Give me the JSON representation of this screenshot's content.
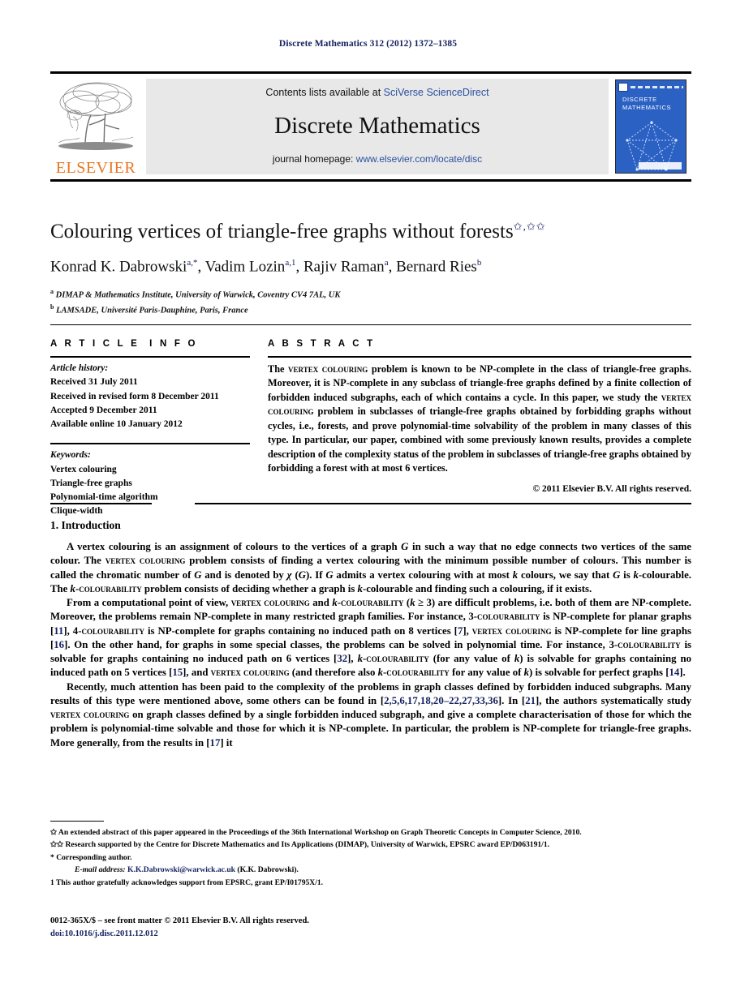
{
  "running_head": "Discrete Mathematics 312 (2012) 1372–1385",
  "masthead": {
    "publisher_name": "ELSEVIER",
    "contents_prefix": "Contents lists available at ",
    "contents_link": "SciVerse ScienceDirect",
    "journal_name": "Discrete Mathematics",
    "homepage_prefix": "journal homepage: ",
    "homepage_url": "www.elsevier.com/locate/disc",
    "cover_title_line1": "DISCRETE",
    "cover_title_line2": "MATHEMATICS"
  },
  "article": {
    "title": "Colouring vertices of triangle-free graphs without forests",
    "title_marks": "✩,✩✩",
    "authors_html": "Konrad K. Dabrowski<sup>a,*</sup>, Vadim Lozin<sup>a,1</sup>, Rajiv Raman<sup>a</sup>, Bernard Ries<sup>b</sup>",
    "affiliations": [
      {
        "mark": "a",
        "text": "DIMAP & Mathematics Institute, University of Warwick, Coventry CV4 7AL, UK"
      },
      {
        "mark": "b",
        "text": "LAMSADE, Université Paris-Dauphine, Paris, France"
      }
    ]
  },
  "info": {
    "heading_left": "A R T I C L E",
    "heading_right": "I N F O",
    "history_label": "Article history:",
    "history": [
      "Received 31 July 2011",
      "Received in revised form 8 December 2011",
      "Accepted 9 December 2011",
      "Available online 10 January 2012"
    ],
    "keywords_label": "Keywords:",
    "keywords": [
      "Vertex colouring",
      "Triangle-free graphs",
      "Polynomial-time algorithm",
      "Clique-width"
    ]
  },
  "abstract": {
    "heading": "A B S T R A C T",
    "text_html": "The <span class=\"sc\">vertex colouring</span> problem is known to be NP-complete in the class of triangle-free graphs. Moreover, it is NP-complete in any subclass of triangle-free graphs defined by a finite collection of forbidden induced subgraphs, each of which contains a cycle. In this paper, we study the <span class=\"sc\">vertex colouring</span> problem in subclasses of triangle-free graphs obtained by forbidding graphs without cycles, i.e., forests, and prove polynomial-time solvability of the problem in many classes of this type. In particular, our paper, combined with some previously known results, provides a complete description of the complexity status of the problem in subclasses of triangle-free graphs obtained by forbidding a forest with at most 6 vertices.",
    "copyright": "© 2011 Elsevier B.V. All rights reserved."
  },
  "body": {
    "section_heading": "1. Introduction",
    "paragraphs_html": [
      "A vertex colouring is an assignment of colours to the vertices of a graph <i>G</i> in such a way that no edge connects two vertices of the same colour. The <span class=\"sc\">vertex colouring</span> problem consists of finding a vertex colouring with the minimum possible number of colours. This number is called the chromatic number of <i>G</i> and is denoted by <i>χ</i> (<i>G</i>). If <i>G</i> admits a vertex colouring with at most <i>k</i> colours, we say that <i>G</i> is <i>k</i>-colourable. The <i>k</i>-<span class=\"sc\">colourability</span> problem consists of deciding whether a graph is <i>k</i>-colourable and finding such a colouring, if it exists.",
      "From a computational point of view, <span class=\"sc\">vertex colouring</span> and <i>k</i>-<span class=\"sc\">colourability</span> (<i>k</i> ≥ 3) are difficult problems, i.e. both of them are NP-complete. Moreover, the problems remain NP-complete in many restricted graph families. For instance, 3-<span class=\"sc\">colourability</span> is NP-complete for planar graphs [<span class=\"ref\">11</span>], 4-<span class=\"sc\">colourability</span> is NP-complete for graphs containing no induced path on 8 vertices [<span class=\"ref\">7</span>], <span class=\"sc\">vertex colouring</span> is NP-complete for line graphs [<span class=\"ref\">16</span>]. On the other hand, for graphs in some special classes, the problems can be solved in polynomial time. For instance, 3-<span class=\"sc\">colourability</span> is solvable for graphs containing no induced path on 6 vertices [<span class=\"ref\">32</span>], <i>k</i>-<span class=\"sc\">colourability</span> (for any value of <i>k</i>) is solvable for graphs containing no induced path on 5 vertices [<span class=\"ref\">15</span>], and <span class=\"sc\">vertex colouring</span> (and therefore also <i>k</i>-<span class=\"sc\">colourability</span> for any value of <i>k</i>) is solvable for perfect graphs [<span class=\"ref\">14</span>].",
      "Recently, much attention has been paid to the complexity of the problems in graph classes defined by forbidden induced subgraphs. Many results of this type were mentioned above, some others can be found in [<span class=\"ref\">2,5,6,17,18,20–22,27,33,36</span>]. In [<span class=\"ref\">21</span>], the authors systematically study <span class=\"sc\">vertex colouring</span> on graph classes defined by a single forbidden induced subgraph, and give a complete characterisation of those for which the problem is polynomial-time solvable and those for which it is NP-complete. In particular, the problem is NP-complete for triangle-free graphs. More generally, from the results in [<span class=\"ref\">17</span>] it"
    ]
  },
  "footnotes": [
    {
      "mark": "✩",
      "html": "An extended abstract of this paper appeared in the Proceedings of the 36th International Workshop on Graph Theoretic Concepts in Computer Science, 2010."
    },
    {
      "mark": "✩✩",
      "html": "Research supported by the Centre for Discrete Mathematics and Its Applications (DIMAP), University of Warwick, EPSRC award EP/D063191/1."
    },
    {
      "mark": "*",
      "html": "Corresponding author."
    },
    {
      "mark": "",
      "html": "<span class=\"email-lbl\">E-mail address:</span> <span class=\"mail\">K.K.Dabrowski@warwick.ac.uk</span> (K.K. Dabrowski)."
    },
    {
      "mark": "1",
      "html": "This author gratefully acknowledges support from EPSRC, grant EP/I01795X/1."
    }
  ],
  "imprint": {
    "line1": "0012-365X/$ – see front matter © 2011 Elsevier B.V. All rights reserved.",
    "doi": "doi:10.1016/j.disc.2011.12.012"
  }
}
